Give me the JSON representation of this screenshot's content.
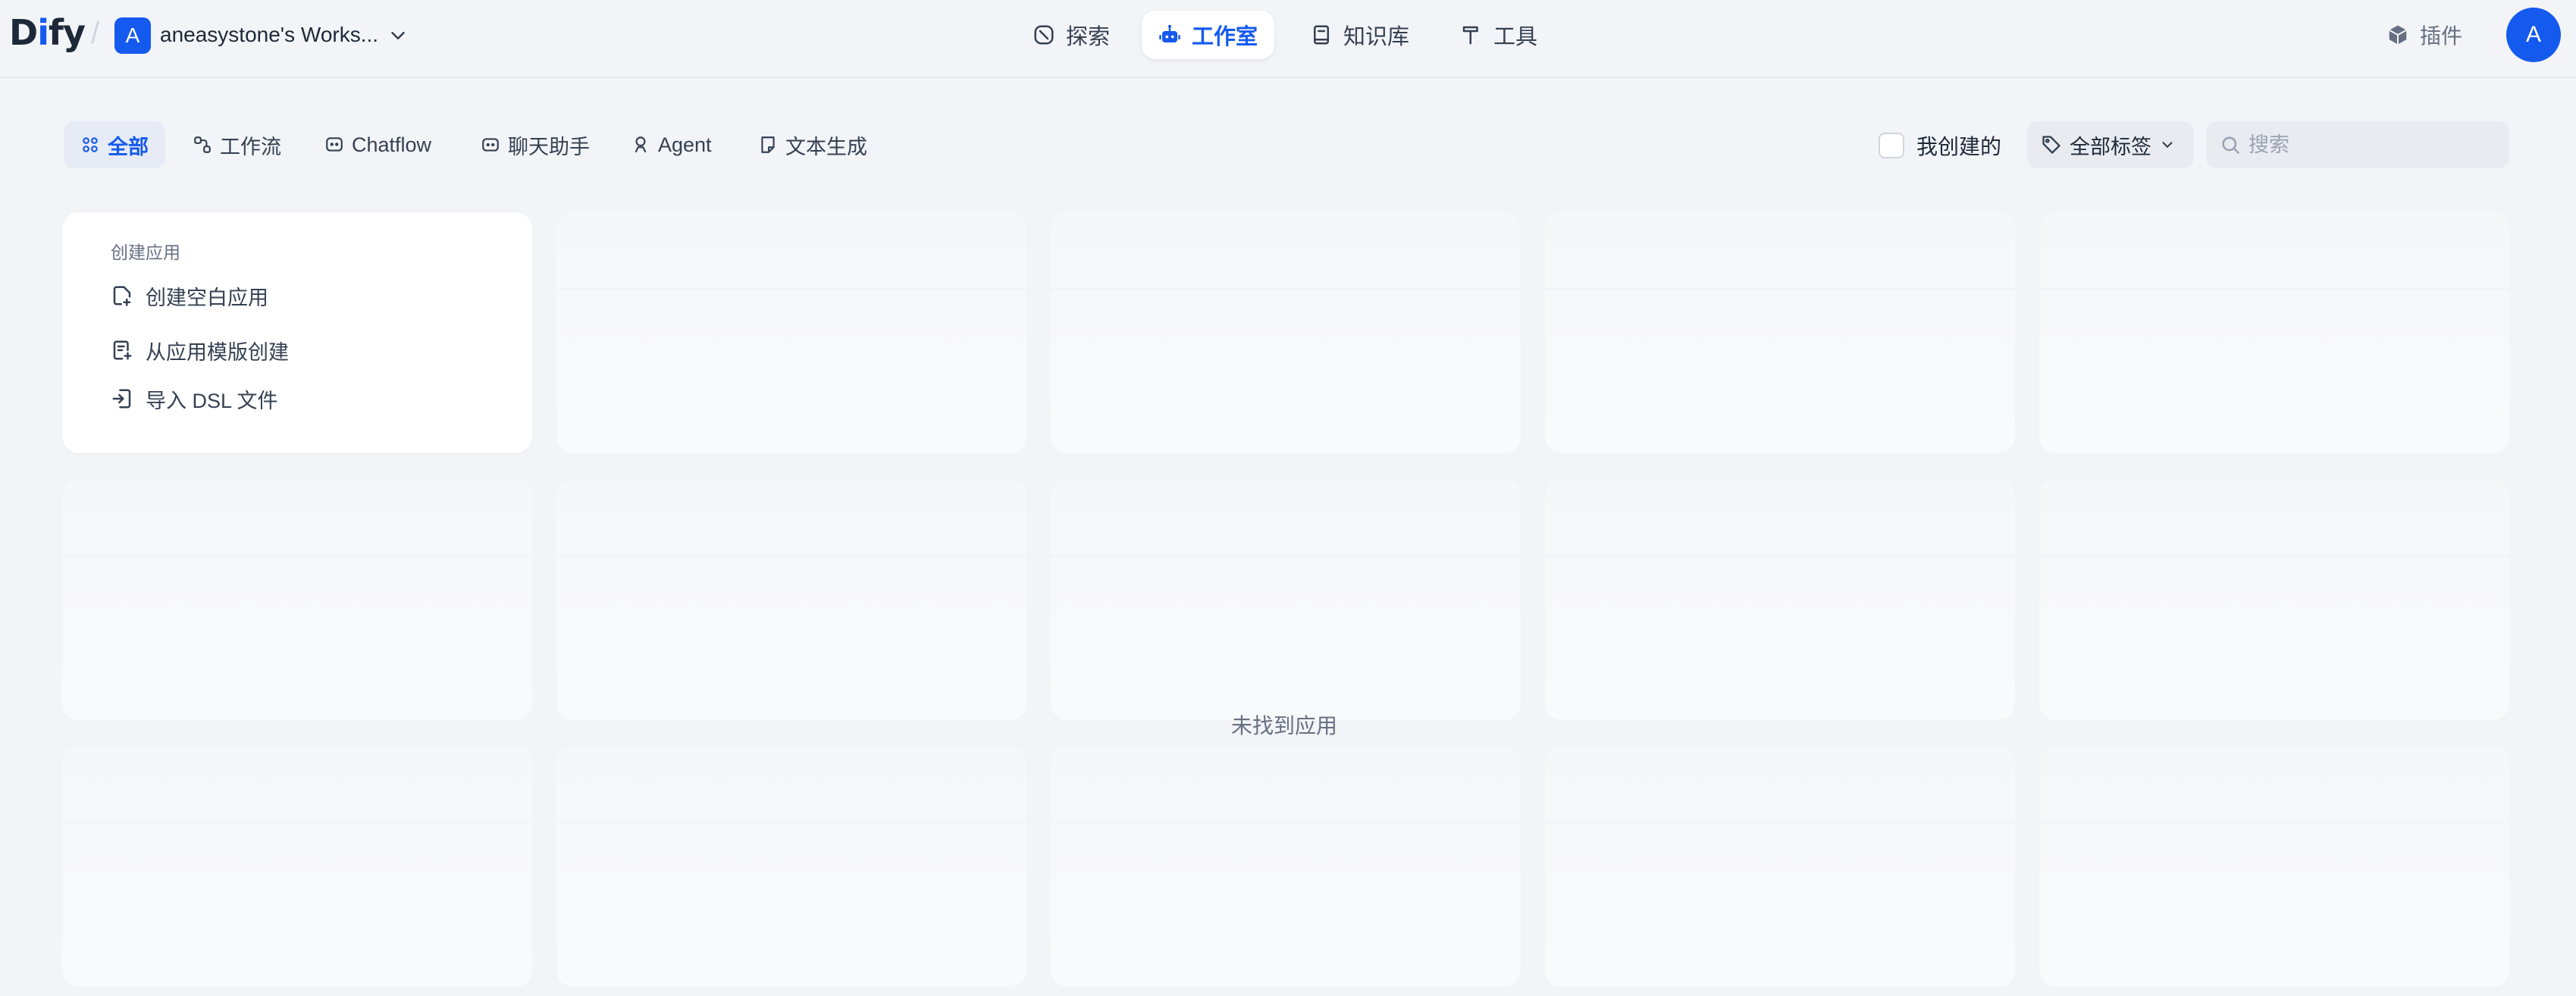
{
  "header": {
    "logo_main": "Di",
    "logo_accent": "i",
    "logo_rest": "fy",
    "workspace_initial": "A",
    "workspace_name": "aneasystone's Works...",
    "nav": [
      {
        "label": "探索",
        "icon": "compass-icon",
        "active": false
      },
      {
        "label": "工作室",
        "icon": "robot-icon",
        "active": true
      },
      {
        "label": "知识库",
        "icon": "book-icon",
        "active": false
      },
      {
        "label": "工具",
        "icon": "hammer-icon",
        "active": false
      }
    ],
    "plugins_label": "插件",
    "user_initial": "A"
  },
  "toolbar": {
    "tabs": [
      {
        "label": "全部",
        "icon": "grid-icon",
        "active": true
      },
      {
        "label": "工作流",
        "icon": "workflow-icon",
        "active": false
      },
      {
        "label": "Chatflow",
        "icon": "chat-bubble-icon",
        "active": false
      },
      {
        "label": "聊天助手",
        "icon": "chat-bot-icon",
        "active": false
      },
      {
        "label": "Agent",
        "icon": "agent-icon",
        "active": false
      },
      {
        "label": "文本生成",
        "icon": "note-icon",
        "active": false
      }
    ],
    "mine_label": "我创建的",
    "tag_filter_label": "全部标签",
    "search_placeholder": "搜索"
  },
  "create_card": {
    "title": "创建应用",
    "items": [
      {
        "label": "创建空白应用",
        "icon": "file-plus-icon"
      },
      {
        "label": "从应用模版创建",
        "icon": "template-icon"
      },
      {
        "label": "导入 DSL 文件",
        "icon": "import-icon"
      }
    ]
  },
  "empty_state": "未找到应用",
  "colors": {
    "accent": "#155aef",
    "background": "#f2f4f7",
    "card": "#ffffff"
  }
}
